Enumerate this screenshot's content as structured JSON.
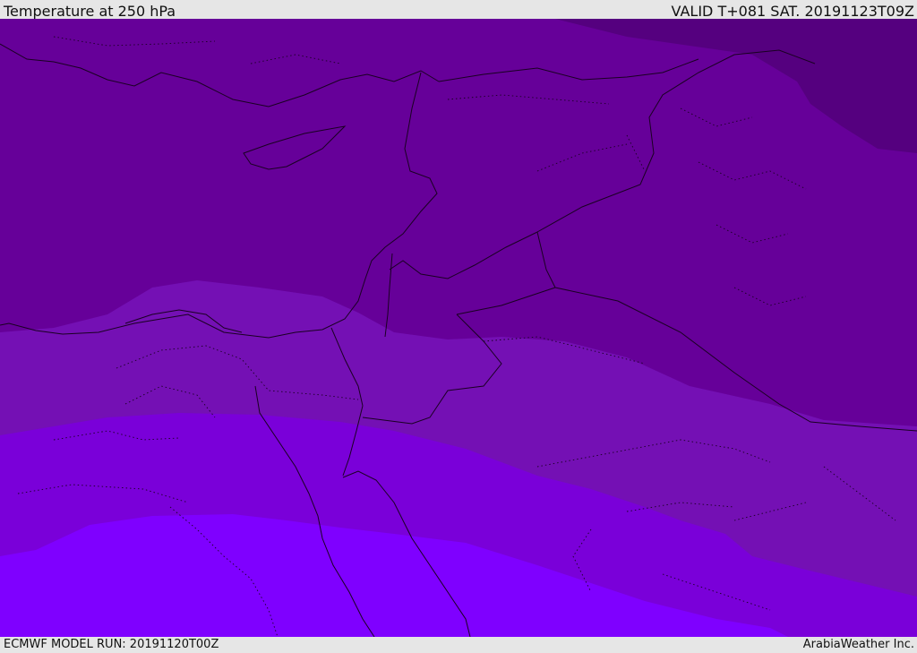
{
  "header": {
    "title": "Temperature at 250 hPa",
    "valid_time": "VALID T+081 SAT. 20191123T09Z"
  },
  "footer": {
    "model_run": "ECMWF MODEL RUN: 20191120T00Z",
    "credit": "ArabiaWeather Inc."
  },
  "colors": {
    "band_coldest": "#55007f",
    "band_1": "#660099",
    "band_2": "#7410b4",
    "band_3": "#7a00d9",
    "band_warmest": "#7f00ff"
  }
}
